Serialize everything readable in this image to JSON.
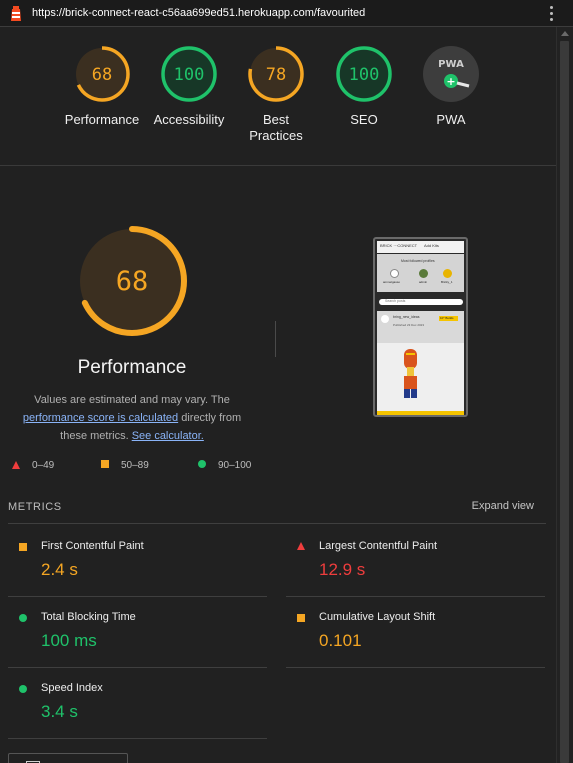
{
  "browser": {
    "url": "https://brick-connect-react-c56aa699ed51.herokuapp.com/favourited"
  },
  "colors": {
    "pass": "#1fc26a",
    "average": "#f5a623",
    "fail": "#ef3d3d"
  },
  "summary": {
    "gauges": [
      {
        "score": "68",
        "label": "Performance",
        "status": "average"
      },
      {
        "score": "100",
        "label": "Accessibility",
        "status": "pass"
      },
      {
        "score": "78",
        "label": "Best Practices",
        "status": "average"
      },
      {
        "score": "100",
        "label": "SEO",
        "status": "pass"
      },
      {
        "score": "",
        "label": "PWA",
        "status": "na",
        "badge": "PWA"
      }
    ]
  },
  "performance": {
    "score": "68",
    "score_fraction": 0.68,
    "title": "Performance",
    "desc_1": "Values are estimated and may vary. The",
    "desc_link_1": "performance score is calculated",
    "desc_2": "directly from these metrics.",
    "desc_link_2": "See calculator."
  },
  "legend": {
    "fail": "0–49",
    "average": "50–89",
    "pass": "90–100"
  },
  "thumbnail": {
    "brand": "BRICK ⋯CONNECT",
    "nav": "Add Kits",
    "section": "Most followed profiles",
    "profiles": [
      "ammelgasso",
      "admin",
      "Bricky_1"
    ],
    "search": "Search posts",
    "post_user": "bring_new_ideas",
    "post_badge": "10° Builds",
    "post_date": "Published 23 Dec 2023"
  },
  "metrics": {
    "heading": "METRICS",
    "expand": "Expand view",
    "items": [
      {
        "name": "First Contentful Paint",
        "value": "2.4 s",
        "status": "average"
      },
      {
        "name": "Largest Contentful Paint",
        "value": "12.9 s",
        "status": "fail"
      },
      {
        "name": "Total Blocking Time",
        "value": "100 ms",
        "status": "pass"
      },
      {
        "name": "Cumulative Layout Shift",
        "value": "0.101",
        "status": "average"
      },
      {
        "name": "Speed Index",
        "value": "3.4 s",
        "status": "pass"
      }
    ]
  }
}
